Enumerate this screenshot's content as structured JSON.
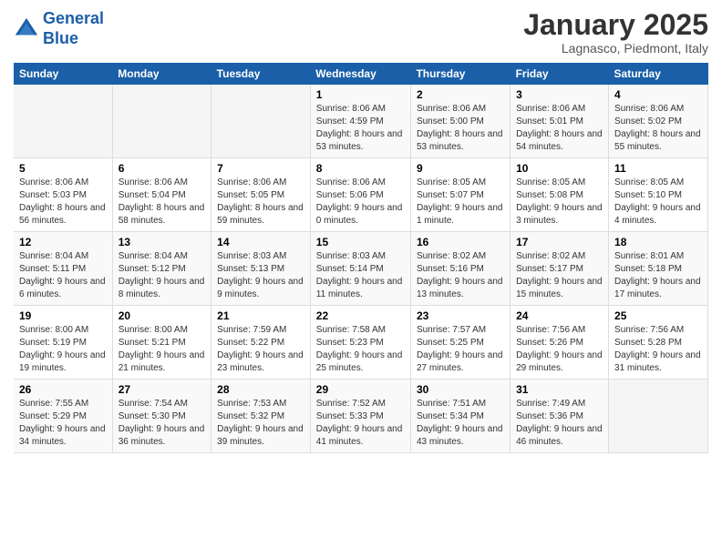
{
  "header": {
    "logo_line1": "General",
    "logo_line2": "Blue",
    "month": "January 2025",
    "location": "Lagnasco, Piedmont, Italy"
  },
  "days_of_week": [
    "Sunday",
    "Monday",
    "Tuesday",
    "Wednesday",
    "Thursday",
    "Friday",
    "Saturday"
  ],
  "weeks": [
    [
      {
        "day": "",
        "info": ""
      },
      {
        "day": "",
        "info": ""
      },
      {
        "day": "",
        "info": ""
      },
      {
        "day": "1",
        "info": "Sunrise: 8:06 AM\nSunset: 4:59 PM\nDaylight: 8 hours and 53 minutes."
      },
      {
        "day": "2",
        "info": "Sunrise: 8:06 AM\nSunset: 5:00 PM\nDaylight: 8 hours and 53 minutes."
      },
      {
        "day": "3",
        "info": "Sunrise: 8:06 AM\nSunset: 5:01 PM\nDaylight: 8 hours and 54 minutes."
      },
      {
        "day": "4",
        "info": "Sunrise: 8:06 AM\nSunset: 5:02 PM\nDaylight: 8 hours and 55 minutes."
      }
    ],
    [
      {
        "day": "5",
        "info": "Sunrise: 8:06 AM\nSunset: 5:03 PM\nDaylight: 8 hours and 56 minutes."
      },
      {
        "day": "6",
        "info": "Sunrise: 8:06 AM\nSunset: 5:04 PM\nDaylight: 8 hours and 58 minutes."
      },
      {
        "day": "7",
        "info": "Sunrise: 8:06 AM\nSunset: 5:05 PM\nDaylight: 8 hours and 59 minutes."
      },
      {
        "day": "8",
        "info": "Sunrise: 8:06 AM\nSunset: 5:06 PM\nDaylight: 9 hours and 0 minutes."
      },
      {
        "day": "9",
        "info": "Sunrise: 8:05 AM\nSunset: 5:07 PM\nDaylight: 9 hours and 1 minute."
      },
      {
        "day": "10",
        "info": "Sunrise: 8:05 AM\nSunset: 5:08 PM\nDaylight: 9 hours and 3 minutes."
      },
      {
        "day": "11",
        "info": "Sunrise: 8:05 AM\nSunset: 5:10 PM\nDaylight: 9 hours and 4 minutes."
      }
    ],
    [
      {
        "day": "12",
        "info": "Sunrise: 8:04 AM\nSunset: 5:11 PM\nDaylight: 9 hours and 6 minutes."
      },
      {
        "day": "13",
        "info": "Sunrise: 8:04 AM\nSunset: 5:12 PM\nDaylight: 9 hours and 8 minutes."
      },
      {
        "day": "14",
        "info": "Sunrise: 8:03 AM\nSunset: 5:13 PM\nDaylight: 9 hours and 9 minutes."
      },
      {
        "day": "15",
        "info": "Sunrise: 8:03 AM\nSunset: 5:14 PM\nDaylight: 9 hours and 11 minutes."
      },
      {
        "day": "16",
        "info": "Sunrise: 8:02 AM\nSunset: 5:16 PM\nDaylight: 9 hours and 13 minutes."
      },
      {
        "day": "17",
        "info": "Sunrise: 8:02 AM\nSunset: 5:17 PM\nDaylight: 9 hours and 15 minutes."
      },
      {
        "day": "18",
        "info": "Sunrise: 8:01 AM\nSunset: 5:18 PM\nDaylight: 9 hours and 17 minutes."
      }
    ],
    [
      {
        "day": "19",
        "info": "Sunrise: 8:00 AM\nSunset: 5:19 PM\nDaylight: 9 hours and 19 minutes."
      },
      {
        "day": "20",
        "info": "Sunrise: 8:00 AM\nSunset: 5:21 PM\nDaylight: 9 hours and 21 minutes."
      },
      {
        "day": "21",
        "info": "Sunrise: 7:59 AM\nSunset: 5:22 PM\nDaylight: 9 hours and 23 minutes."
      },
      {
        "day": "22",
        "info": "Sunrise: 7:58 AM\nSunset: 5:23 PM\nDaylight: 9 hours and 25 minutes."
      },
      {
        "day": "23",
        "info": "Sunrise: 7:57 AM\nSunset: 5:25 PM\nDaylight: 9 hours and 27 minutes."
      },
      {
        "day": "24",
        "info": "Sunrise: 7:56 AM\nSunset: 5:26 PM\nDaylight: 9 hours and 29 minutes."
      },
      {
        "day": "25",
        "info": "Sunrise: 7:56 AM\nSunset: 5:28 PM\nDaylight: 9 hours and 31 minutes."
      }
    ],
    [
      {
        "day": "26",
        "info": "Sunrise: 7:55 AM\nSunset: 5:29 PM\nDaylight: 9 hours and 34 minutes."
      },
      {
        "day": "27",
        "info": "Sunrise: 7:54 AM\nSunset: 5:30 PM\nDaylight: 9 hours and 36 minutes."
      },
      {
        "day": "28",
        "info": "Sunrise: 7:53 AM\nSunset: 5:32 PM\nDaylight: 9 hours and 39 minutes."
      },
      {
        "day": "29",
        "info": "Sunrise: 7:52 AM\nSunset: 5:33 PM\nDaylight: 9 hours and 41 minutes."
      },
      {
        "day": "30",
        "info": "Sunrise: 7:51 AM\nSunset: 5:34 PM\nDaylight: 9 hours and 43 minutes."
      },
      {
        "day": "31",
        "info": "Sunrise: 7:49 AM\nSunset: 5:36 PM\nDaylight: 9 hours and 46 minutes."
      },
      {
        "day": "",
        "info": ""
      }
    ]
  ]
}
